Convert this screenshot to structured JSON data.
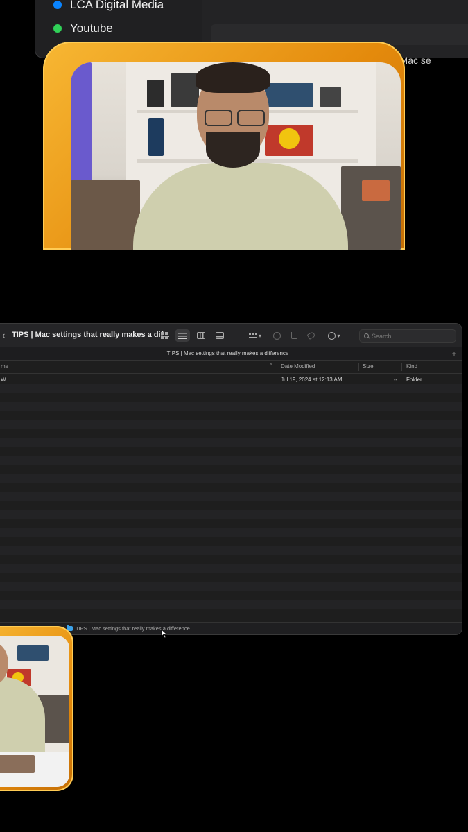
{
  "top_window": {
    "tags": [
      {
        "label": "LCA Digital Media",
        "color": "#0a84ff"
      },
      {
        "label": "Youtube",
        "color": "#30d158"
      }
    ],
    "path_label": "TIPS | Mac se"
  },
  "finder": {
    "back_symbol": "‹",
    "title": "TIPS | Mac settings that really makes a dif...",
    "path_tab": "TIPS | Mac settings that really makes a difference",
    "add_tab_symbol": "+",
    "search_placeholder": "Search",
    "columns": {
      "name": "me",
      "date_modified": "Date Modified",
      "size": "Size",
      "kind": "Kind",
      "sort_indicator": "^"
    },
    "rows": [
      {
        "name": "W",
        "date_modified": "Jul 19, 2024 at 12:13 AM",
        "size": "--",
        "kind": "Folder"
      }
    ],
    "status_path": "TIPS | Mac settings that really makes a difference"
  },
  "colors": {
    "frame_orange": "#e48a0c",
    "folder_blue": "#3ba2ea",
    "window_bg": "#1e1e1e"
  }
}
